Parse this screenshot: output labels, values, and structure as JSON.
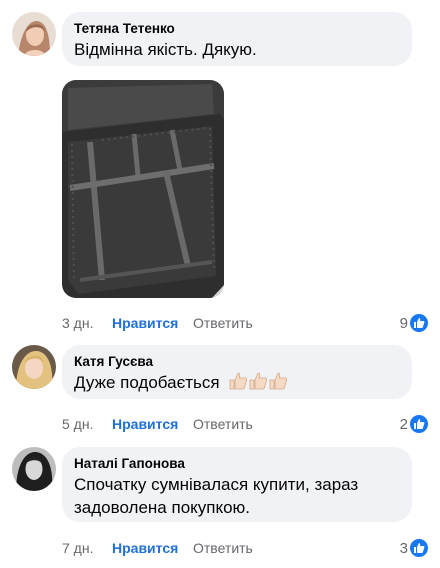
{
  "comments": [
    {
      "author": "Тетяна Тетенко",
      "text": "Відмінна якість. Дякую.",
      "time": "3 дн.",
      "like_label": "Нравится",
      "reply_label": "Ответить",
      "reaction_count": "9",
      "reaction_icon": "like-icon",
      "avatar_color": "#c9a78e"
    },
    {
      "author": "Катя Гусєва",
      "text": "Дуже подобається",
      "emoji": "👍🏻👍🏻👍🏻",
      "time": "5 дн.",
      "like_label": "Нравится",
      "reply_label": "Ответить",
      "reaction_count": "2",
      "reaction_icon": "like-icon",
      "avatar_color": "#d9bf8a"
    },
    {
      "author": "Наталі Гапонова",
      "text_line1": "Спочатку сумнівалася купити, зараз",
      "text_line2": "задоволена покупкою.",
      "time": "7 дн.",
      "like_label": "Нравится",
      "reply_label": "Ответить",
      "reaction_count": "3",
      "reaction_icon": "like-icon",
      "avatar_color": "#3a3a3a"
    }
  ],
  "colors": {
    "bubble": "#f0f2f5",
    "meta_text": "#65676b",
    "like_text": "#216fdb",
    "like_badge": "#1877f2"
  },
  "photo_icon": "cosmetic-case-photo"
}
